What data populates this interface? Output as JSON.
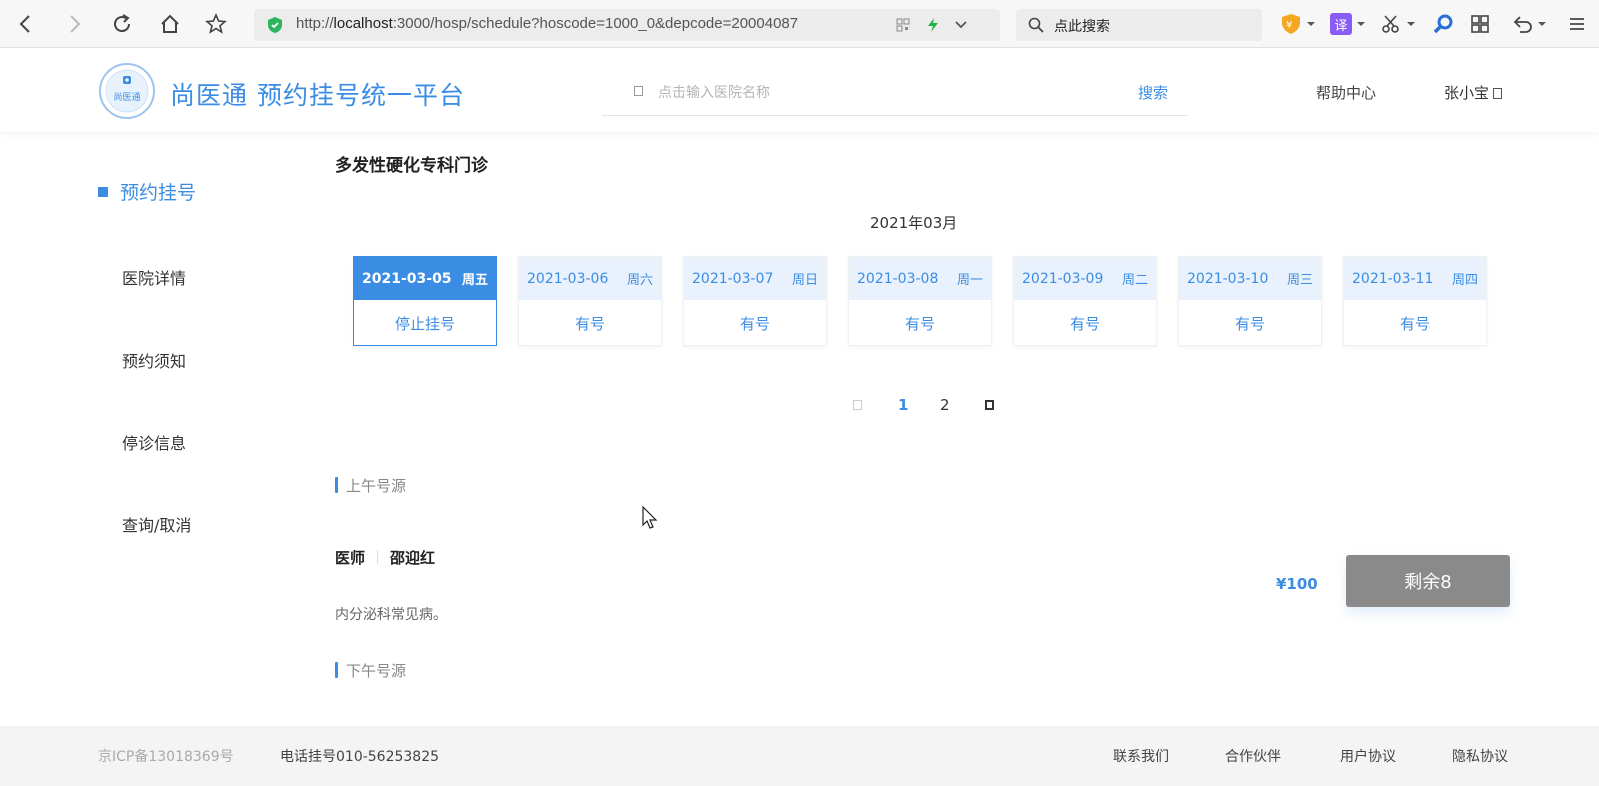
{
  "browser": {
    "url_prefix": "http://",
    "url_host": "localhost",
    "url_rest": ":3000/hosp/schedule?hoscode=1000_0&depcode=20004087",
    "search_placeholder": "点此搜索",
    "extensions": [
      "shield-extension",
      "translate-extension",
      "scissors-extension",
      "magnifier-extension",
      "grid-extension",
      "undo-extension",
      "menu"
    ],
    "ext_translate_label": "译"
  },
  "header": {
    "site_title": "尚医通 预约挂号统一平台",
    "logo_text": "尚医通",
    "search_placeholder": "点击输入医院名称",
    "search_button": "搜索",
    "help": "帮助中心",
    "user_name": "张小宝"
  },
  "sidebar": {
    "active": "预约挂号",
    "items": [
      {
        "label": "医院详情"
      },
      {
        "label": "预约须知"
      },
      {
        "label": "停诊信息"
      },
      {
        "label": "查询/取消"
      }
    ]
  },
  "main": {
    "department": "多发性硬化专科门诊",
    "month": "2021年03月",
    "days": [
      {
        "date": "2021-03-05",
        "weekday": "周五",
        "status": "停止挂号"
      },
      {
        "date": "2021-03-06",
        "weekday": "周六",
        "status": "有号"
      },
      {
        "date": "2021-03-07",
        "weekday": "周日",
        "status": "有号"
      },
      {
        "date": "2021-03-08",
        "weekday": "周一",
        "status": "有号"
      },
      {
        "date": "2021-03-09",
        "weekday": "周二",
        "status": "有号"
      },
      {
        "date": "2021-03-10",
        "weekday": "周三",
        "status": "有号"
      },
      {
        "date": "2021-03-11",
        "weekday": "周四",
        "status": "有号"
      }
    ],
    "selected_index": 0,
    "pager": {
      "pages": [
        "1",
        "2"
      ],
      "current": "1"
    },
    "morning_label": "上午号源",
    "afternoon_label": "下午号源",
    "doctor": {
      "title": "医师",
      "name": "邵迎红",
      "desc": "内分泌科常见病。",
      "price": "¥100",
      "remain_button": "剩余8"
    }
  },
  "footer": {
    "icp": "京ICP备13018369号",
    "phone": "电话挂号010-56253825",
    "links": [
      "联系我们",
      "合作伙伴",
      "用户协议",
      "隐私协议"
    ]
  },
  "colors": {
    "accent": "#3b8de4",
    "button_disabled": "#8a8a8a"
  }
}
